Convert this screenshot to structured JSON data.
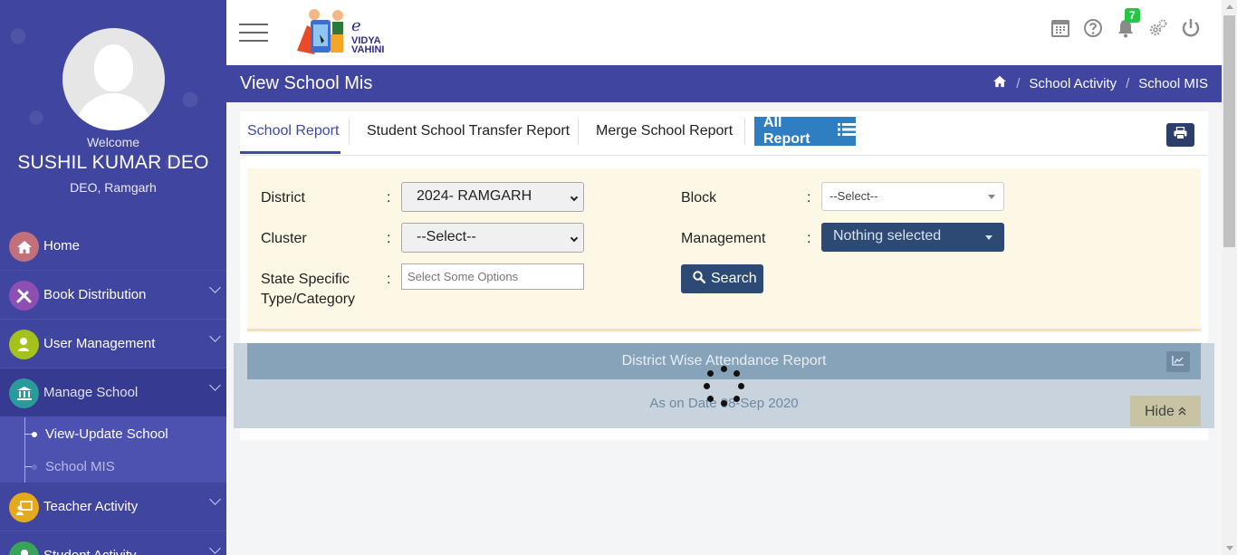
{
  "sidebar": {
    "welcome": "Welcome",
    "user_name": "SUSHIL KUMAR DEO",
    "user_role": "DEO, Ramgarh",
    "items": [
      {
        "label": "Home",
        "icon": "home-icon",
        "color": "#c2717a"
      },
      {
        "label": "Book Distribution",
        "icon": "tools-icon",
        "color": "#8e4fb3"
      },
      {
        "label": "User Management",
        "icon": "user-icon",
        "color": "#a4c21a"
      },
      {
        "label": "Manage School",
        "icon": "institution-icon",
        "color": "#2a9a9b"
      },
      {
        "label": "Teacher Activity",
        "icon": "teacher-icon",
        "color": "#e5a91d"
      },
      {
        "label": "Student Activity",
        "icon": "student-icon",
        "color": "#3aa35a"
      }
    ],
    "submenu": [
      {
        "label": "View-Update School"
      },
      {
        "label": "School MIS"
      }
    ]
  },
  "header": {
    "logo_e": "e",
    "logo_vidya": "VIDYA",
    "logo_vahini": "VAHINI",
    "notification_count": "7"
  },
  "titlebar": {
    "title": "View School Mis",
    "breadcrumb": [
      "School Activity",
      "School MIS"
    ]
  },
  "tabs": [
    {
      "label": "School Report"
    },
    {
      "label": "Student School Transfer Report"
    },
    {
      "label": "Merge School Report"
    }
  ],
  "all_report_label": "All Report",
  "filters": {
    "district_label": "District",
    "district_value": "2024- RAMGARH",
    "block_label": "Block",
    "block_value": "--Select--",
    "cluster_label": "Cluster",
    "cluster_value": "--Select--",
    "management_label": "Management",
    "management_value": "Nothing selected",
    "state_label_1": "State Specific",
    "state_label_2": "Type/Category",
    "state_placeholder": "Select Some Options",
    "colon": ":",
    "search_label": "Search"
  },
  "report": {
    "title": "District Wise Attendance Report",
    "as_on": "As on Date 08-Sep 2020",
    "hide_label": "Hide"
  }
}
